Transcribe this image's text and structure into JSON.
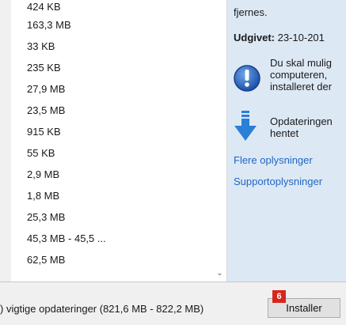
{
  "update_sizes": [
    "424 KB",
    "163,3 MB",
    "33 KB",
    "235 KB",
    "27,9 MB",
    "23,5 MB",
    "915 KB",
    "55 KB",
    "2,9 MB",
    "1,8 MB",
    "25,3 MB",
    "45,3 MB - 45,5 ...",
    "62,5 MB"
  ],
  "details": {
    "removed_text": "fjernes.",
    "published_label": "Udgivet:",
    "published_value": "23-10-201",
    "restart_notice_lines": [
      "Du skal mulig",
      "computeren,",
      "installeret der"
    ],
    "download_notice_lines": [
      "Opdateringen",
      "hentet"
    ],
    "more_info_link": "Flere oplysninger",
    "support_info_link": "Supportoplysninger"
  },
  "footer": {
    "summary_text": ") vigtige opdateringer (821,6 MB - 822,2 MB)",
    "install_label": "Installer",
    "step_badge": "6"
  },
  "colors": {
    "link": "#1f66c2",
    "badge": "#d7261e",
    "detail_background": "#dde8f5"
  },
  "icons": {
    "restart_notice": "info-exclamation-icon",
    "download_notice": "download-arrow-icon",
    "scroll_down": "chevron-down-icon"
  }
}
